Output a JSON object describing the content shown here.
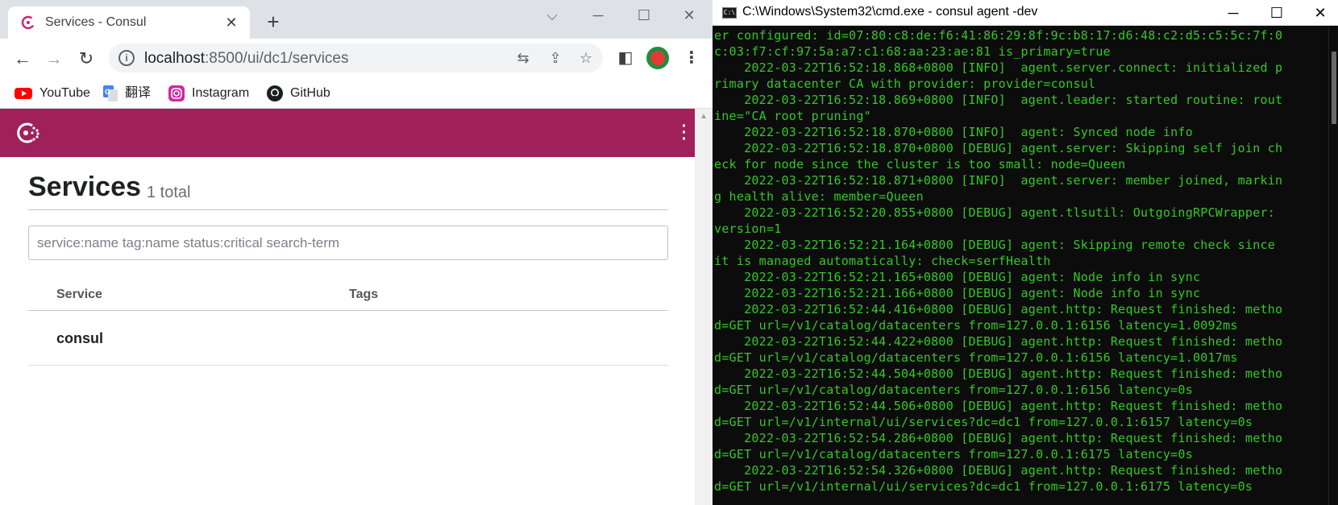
{
  "browser": {
    "tab_title": "Services - Consul",
    "tab_close": "✕",
    "new_tab": "+",
    "url_host": "localhost",
    "url_rest": ":8500/ui/dc1/services",
    "bookmarks": [
      {
        "label": "YouTube",
        "icon": "youtube-icon"
      },
      {
        "label": "翻译",
        "icon": "translate-icon"
      },
      {
        "label": "Instagram",
        "icon": "instagram-icon"
      },
      {
        "label": "GitHub",
        "icon": "github-icon"
      }
    ]
  },
  "consul": {
    "brand_color": "#a0205a",
    "title": "Services",
    "count": "1 total",
    "search_placeholder": "service:name tag:name status:critical search-term",
    "columns": [
      "Service",
      "Tags"
    ],
    "rows": [
      {
        "service": "consul",
        "tags": ""
      }
    ]
  },
  "console": {
    "title": "C:\\Windows\\System32\\cmd.exe - consul  agent -dev",
    "text_color": "#34c924",
    "lines": [
      "er configured: id=07:80:c8:de:f6:41:86:29:8f:9c:b8:17:d6:48:c2:d5:c5:5c:7f:0",
      "c:03:f7:cf:97:5a:a7:c1:68:aa:23:ae:81 is_primary=true",
      "    2022-03-22T16:52:18.868+0800 [INFO]  agent.server.connect: initialized p",
      "rimary datacenter CA with provider: provider=consul",
      "    2022-03-22T16:52:18.869+0800 [INFO]  agent.leader: started routine: rout",
      "ine=\"CA root pruning\"",
      "    2022-03-22T16:52:18.870+0800 [INFO]  agent: Synced node info",
      "    2022-03-22T16:52:18.870+0800 [DEBUG] agent.server: Skipping self join ch",
      "eck for node since the cluster is too small: node=Queen",
      "    2022-03-22T16:52:18.871+0800 [INFO]  agent.server: member joined, markin",
      "g health alive: member=Queen",
      "    2022-03-22T16:52:20.855+0800 [DEBUG] agent.tlsutil: OutgoingRPCWrapper:",
      "version=1",
      "    2022-03-22T16:52:21.164+0800 [DEBUG] agent: Skipping remote check since",
      "it is managed automatically: check=serfHealth",
      "    2022-03-22T16:52:21.165+0800 [DEBUG] agent: Node info in sync",
      "    2022-03-22T16:52:21.166+0800 [DEBUG] agent: Node info in sync",
      "    2022-03-22T16:52:44.416+0800 [DEBUG] agent.http: Request finished: metho",
      "d=GET url=/v1/catalog/datacenters from=127.0.0.1:6156 latency=1.0092ms",
      "    2022-03-22T16:52:44.422+0800 [DEBUG] agent.http: Request finished: metho",
      "d=GET url=/v1/catalog/datacenters from=127.0.0.1:6156 latency=1.0017ms",
      "    2022-03-22T16:52:44.504+0800 [DEBUG] agent.http: Request finished: metho",
      "d=GET url=/v1/catalog/datacenters from=127.0.0.1:6156 latency=0s",
      "    2022-03-22T16:52:44.506+0800 [DEBUG] agent.http: Request finished: metho",
      "d=GET url=/v1/internal/ui/services?dc=dc1 from=127.0.0.1:6157 latency=0s",
      "    2022-03-22T16:52:54.286+0800 [DEBUG] agent.http: Request finished: metho",
      "d=GET url=/v1/catalog/datacenters from=127.0.0.1:6175 latency=0s",
      "    2022-03-22T16:52:54.326+0800 [DEBUG] agent.http: Request finished: metho",
      "d=GET url=/v1/internal/ui/services?dc=dc1 from=127.0.0.1:6175 latency=0s"
    ]
  }
}
